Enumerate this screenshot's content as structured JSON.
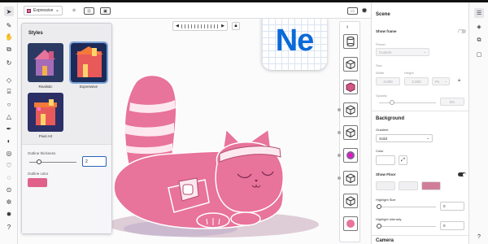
{
  "topbar": {
    "mode_label": "Expressive"
  },
  "timeline": {
    "prev": "◀",
    "next": "▶"
  },
  "logo": {
    "text": "Ne"
  },
  "styles_panel": {
    "title": "Styles",
    "styles": [
      {
        "label": "Realistic"
      },
      {
        "label": "Expressive",
        "selected": true
      },
      {
        "label": "Pixel Art"
      }
    ],
    "outline_thickness_label": "Outline thickness",
    "outline_thickness_value": "2",
    "outline_thickness_fraction": 0.2,
    "outline_color_label": "Outline color",
    "outline_color": "#e0608a"
  },
  "scene": {
    "title": "Scene",
    "show_frame_label": "Show frame",
    "show_frame_on": false,
    "preset_label": "Preset",
    "preset_value": "Custom",
    "size_label": "Size",
    "width_label": "Width",
    "height_label": "Height",
    "width_value": "2,000",
    "height_value": "2,000",
    "unit_value": "Px",
    "opacity_label": "Opacity",
    "opacity_value": "0%",
    "background_title": "Background",
    "gradient_label": "Gradient",
    "gradient_value": "Solid",
    "color_label": "Color",
    "show_floor_label": "Show Floor",
    "show_floor_on": true,
    "floor_colors": [
      "#f0f0f2",
      "#f0f0f2",
      "#d07d99"
    ],
    "highlight_size_label": "Highlight Size",
    "highlight_size_value": "0",
    "highlight_intensity_label": "Highlight Intensity",
    "highlight_intensity_value": "0",
    "camera_title": "Camera"
  },
  "colors": {
    "accent_pink": "#e8739b",
    "brand_blue": "#0b6ad8",
    "focus_blue": "#2a63b8"
  }
}
